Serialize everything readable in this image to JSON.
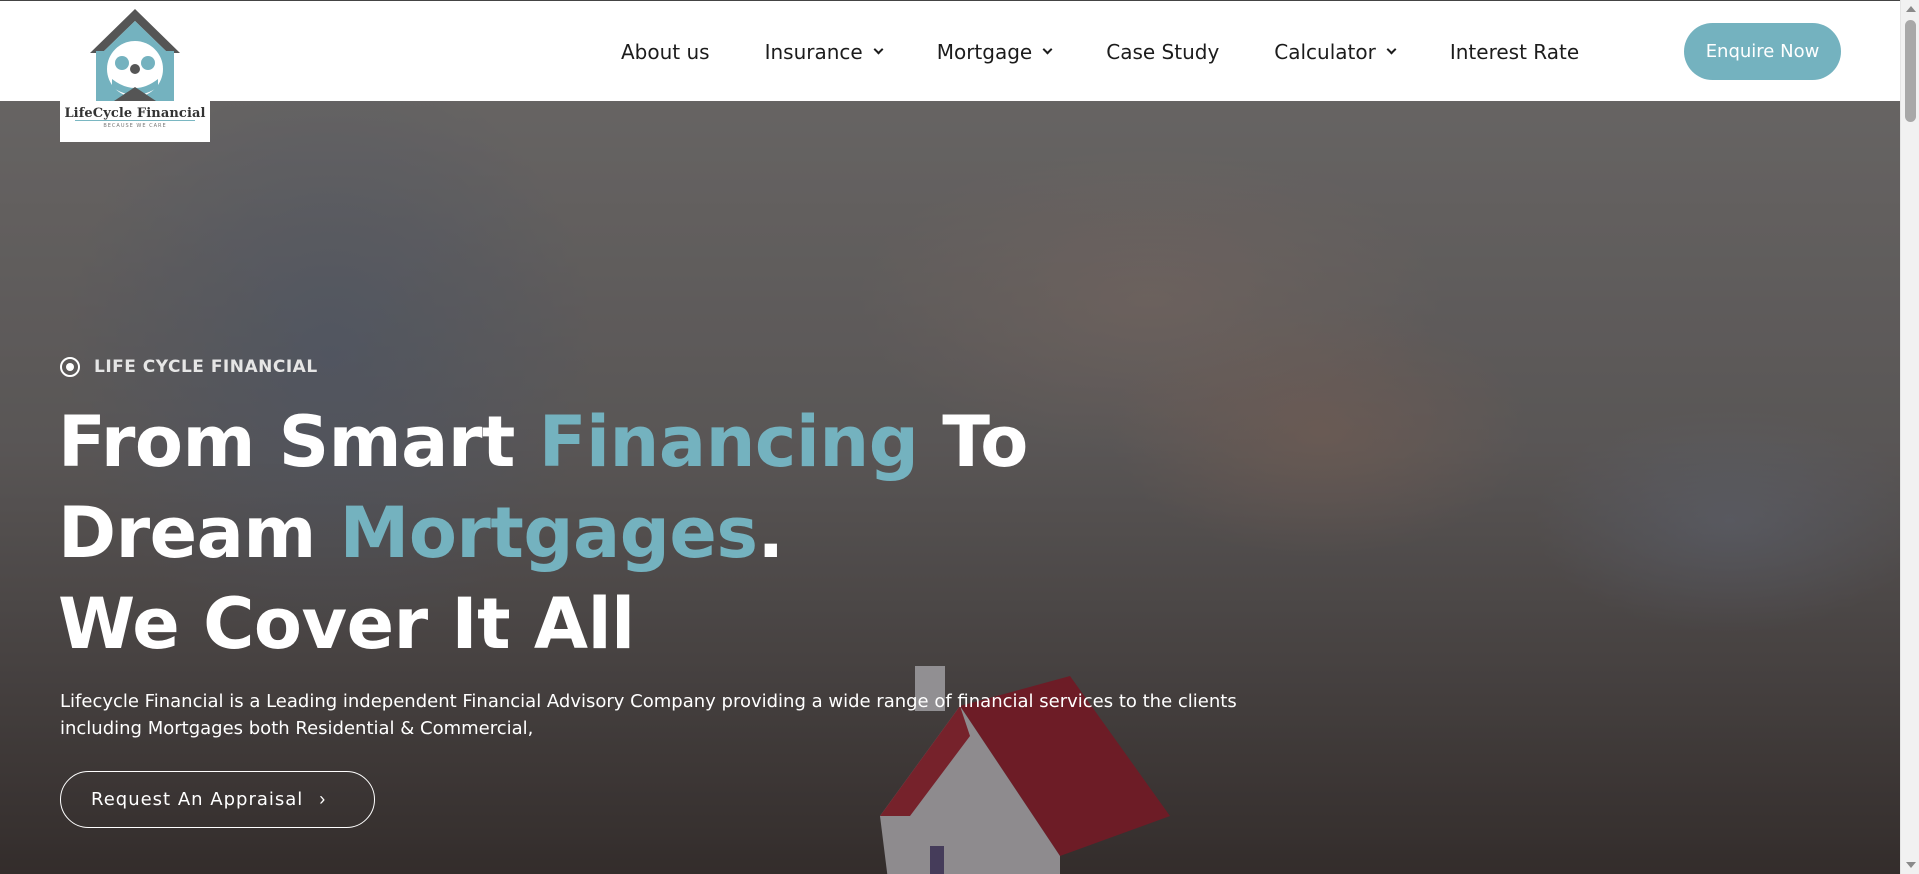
{
  "header": {
    "logo": {
      "name": "LifeCycle Financial",
      "tagline": "BECAUSE WE CARE"
    },
    "nav": [
      {
        "label": "About us",
        "dropdown": false
      },
      {
        "label": "Insurance",
        "dropdown": true
      },
      {
        "label": "Mortgage",
        "dropdown": true
      },
      {
        "label": "Case Study",
        "dropdown": false
      },
      {
        "label": "Calculator",
        "dropdown": true
      },
      {
        "label": "Interest Rate",
        "dropdown": false
      }
    ],
    "cta_label": "Enquire Now"
  },
  "hero": {
    "eyebrow": "LIFE CYCLE FINANCIAL",
    "headline": {
      "l1_a": "From Smart ",
      "l1_accent": "Financing",
      "l1_b": " To",
      "l2_a": "Dream ",
      "l2_accent": "Mortgages",
      "l2_b": ".",
      "l3": "We Cover It All"
    },
    "description": "Lifecycle Financial is a Leading independent Financial Advisory Company providing a wide range of financial services to the clients including Mortgages both Residential & Commercial,",
    "button_label": "Request An Appraisal",
    "button_arrow": "›"
  },
  "colors": {
    "accent": "#74b2bf",
    "header_bg": "#ffffff",
    "text_dark": "#1c1c1c"
  },
  "icons": [
    "house-family-logo-icon",
    "target-circle-icon",
    "chevron-down-icon",
    "chevron-right-icon"
  ]
}
